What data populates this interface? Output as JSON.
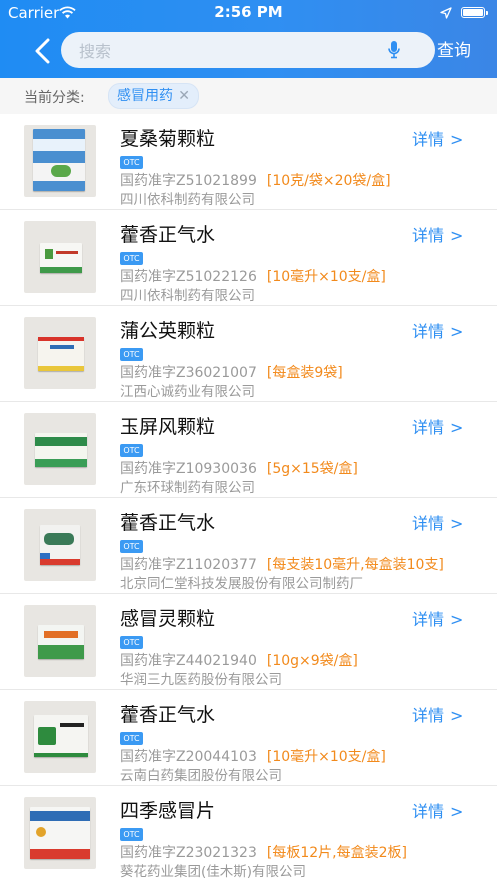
{
  "status_bar": {
    "carrier": "Carrier",
    "time": "2:56 PM"
  },
  "header": {
    "search_placeholder": "搜索",
    "query_label": "查询"
  },
  "category": {
    "label": "当前分类:",
    "tag": "感冒用药"
  },
  "colors": {
    "accent": "#2f8ff2",
    "spec": "#f28a1c"
  },
  "items": [
    {
      "name": "夏桑菊颗粒",
      "badge": "OTC",
      "approval": "国药准字Z51021899",
      "spec": "[10克/袋×20袋/盒]",
      "company": "四川依科制药有限公司",
      "detail": "详情"
    },
    {
      "name": "藿香正气水",
      "badge": "OTC",
      "approval": "国药准字Z51022126",
      "spec": "[10毫升×10支/盒]",
      "company": "四川依科制药有限公司",
      "detail": "详情"
    },
    {
      "name": "蒲公英颗粒",
      "badge": "OTC",
      "approval": "国药准字Z36021007",
      "spec": "[每盒装9袋]",
      "company": "江西心诚药业有限公司",
      "detail": "详情"
    },
    {
      "name": "玉屏风颗粒",
      "badge": "OTC",
      "approval": "国药准字Z10930036",
      "spec": "[5g×15袋/盒]",
      "company": "广东环球制药有限公司",
      "detail": "详情"
    },
    {
      "name": "藿香正气水",
      "badge": "OTC",
      "approval": "国药准字Z11020377",
      "spec": "[每支装10毫升,每盒装10支]",
      "company": "北京同仁堂科技发展股份有限公司制药厂",
      "detail": "详情"
    },
    {
      "name": "感冒灵颗粒",
      "badge": "OTC",
      "approval": "国药准字Z44021940",
      "spec": "[10g×9袋/盒]",
      "company": "华润三九医药股份有限公司",
      "detail": "详情"
    },
    {
      "name": "藿香正气水",
      "badge": "OTC",
      "approval": "国药准字Z20044103",
      "spec": "[10毫升×10支/盒]",
      "company": "云南白药集团股份有限公司",
      "detail": "详情"
    },
    {
      "name": "四季感冒片",
      "badge": "OTC",
      "approval": "国药准字Z23021323",
      "spec": "[每板12片,每盒装2板]",
      "company": "葵花药业集团(佳木斯)有限公司",
      "detail": "详情"
    }
  ]
}
